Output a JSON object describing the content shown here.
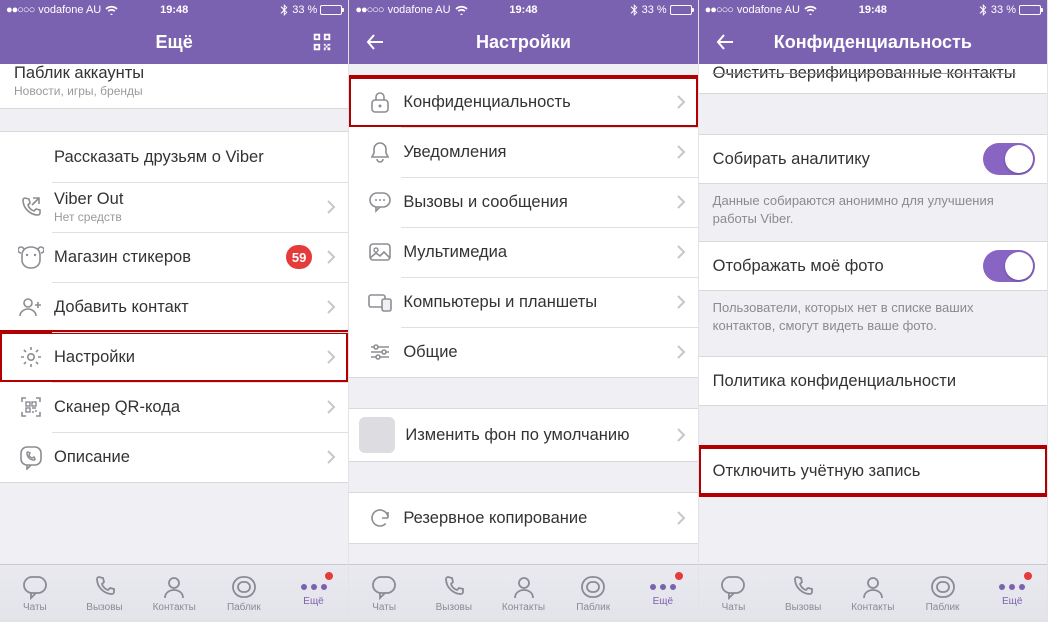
{
  "status": {
    "carrier": "vodafone AU",
    "time": "19:48",
    "battery_pct": "33 %",
    "signal_dots": "●●○○○"
  },
  "screen1": {
    "title": "Ещё",
    "partial": {
      "label": "Паблик аккаунты",
      "sub": "Новости, игры, бренды"
    },
    "rows": {
      "tell_friends": "Рассказать друзьям о Viber",
      "viber_out": "Viber Out",
      "viber_out_sub": "Нет средств",
      "stickers": "Магазин стикеров",
      "stickers_badge": "59",
      "add_contact": "Добавить контакт",
      "settings": "Настройки",
      "qr_scanner": "Сканер QR-кода",
      "about": "Описание"
    }
  },
  "screen2": {
    "title": "Настройки",
    "rows": {
      "privacy": "Конфиденциальность",
      "notifications": "Уведомления",
      "calls_msgs": "Вызовы и сообщения",
      "media": "Мультимедиа",
      "computers": "Компьютеры и планшеты",
      "general": "Общие",
      "wallpaper": "Изменить фон по умолчанию",
      "backup": "Резервное копирование"
    }
  },
  "screen3": {
    "title": "Конфиденциальность",
    "partial": "Очистить верифицированные контакты",
    "rows": {
      "analytics": "Собирать аналитику",
      "analytics_note": "Данные собираются анонимно для улучшения работы Viber.",
      "show_photo": "Отображать моё фото",
      "show_photo_note": "Пользователи, которых нет в списке ваших контактов, смогут видеть ваше фото.",
      "policy": "Политика конфиденциальности",
      "deactivate": "Отключить учётную запись"
    }
  },
  "tabs": {
    "chats": "Чаты",
    "calls": "Вызовы",
    "contacts": "Контакты",
    "public": "Паблик",
    "more": "Ещё"
  }
}
